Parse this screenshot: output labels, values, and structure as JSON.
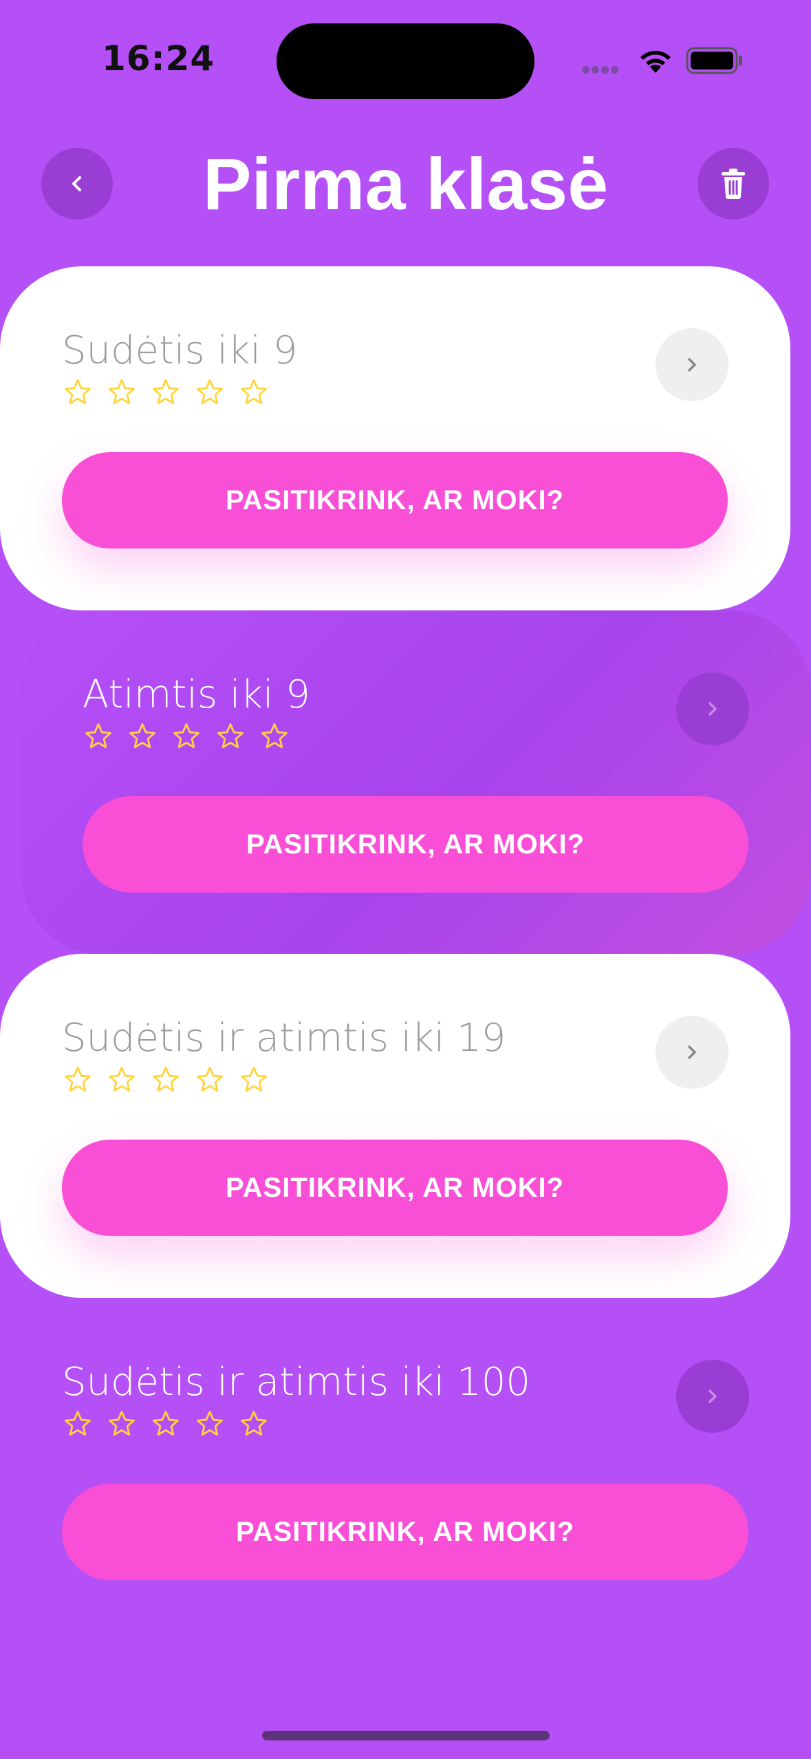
{
  "status_bar": {
    "time": "16:24"
  },
  "header": {
    "title": "Pirma klasė"
  },
  "cards": [
    {
      "title": "Sudėtis iki 9",
      "button_label": "PASITIKRINK, AR MOKI?",
      "stars": 0,
      "max_stars": 5
    },
    {
      "title": "Atimtis iki 9",
      "button_label": "PASITIKRINK, AR MOKI?",
      "stars": 0,
      "max_stars": 5
    },
    {
      "title": "Sudėtis ir atimtis iki 19",
      "button_label": "PASITIKRINK, AR MOKI?",
      "stars": 0,
      "max_stars": 5
    },
    {
      "title": "Sudėtis ir atimtis iki 100",
      "button_label": "PASITIKRINK, AR MOKI?",
      "stars": 0,
      "max_stars": 5
    }
  ],
  "icons": {
    "back": "chevron-left-icon",
    "trash": "trash-icon",
    "chevron": "chevron-right-icon",
    "star": "star-outline-icon"
  },
  "colors": {
    "background": "#b54ff6",
    "button": "#f84fd6",
    "star": "#ffd43b",
    "round_button": "#9a3dd4"
  }
}
